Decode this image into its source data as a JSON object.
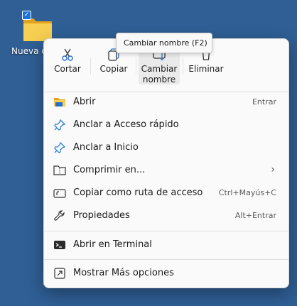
{
  "desktop": {
    "icon_label": "Nueva ca",
    "colors": {
      "background": "#2f5f95"
    }
  },
  "context_menu": {
    "quick_actions": [
      {
        "label": "Cortar",
        "icon": "scissors-icon"
      },
      {
        "label": "Copiar",
        "icon": "copy-icon"
      },
      {
        "label": "Cambiar\nnombre",
        "icon": "rename-icon"
      },
      {
        "label": "Eliminar",
        "icon": "trash-icon"
      }
    ],
    "items": [
      {
        "label": "Abrir",
        "shortcut": "Entrar",
        "icon": "folder-icon"
      },
      {
        "label": "Anclar a Acceso rápido",
        "shortcut": "",
        "icon": "pin-icon"
      },
      {
        "label": "Anclar a Inicio",
        "shortcut": "",
        "icon": "pin-icon"
      },
      {
        "label": "Comprimir en...",
        "shortcut": "",
        "icon": "zip-icon",
        "submenu": true
      },
      {
        "label": "Copiar como ruta de acceso",
        "shortcut": "Ctrl+Mayús+C",
        "icon": "path-icon"
      },
      {
        "label": "Propiedades",
        "shortcut": "Alt+Entrar",
        "icon": "wrench-icon"
      },
      {
        "label": "Abrir en Terminal",
        "shortcut": "",
        "icon": "terminal-icon"
      },
      {
        "label": "Mostrar Más opciones",
        "shortcut": "",
        "icon": "more-options-icon"
      }
    ]
  },
  "tooltip": {
    "text": "Cambiar nombre (F2)"
  },
  "colors": {
    "accent": "#1a73d8",
    "pin": "#2f80d1",
    "folder": "#f3c13a"
  }
}
